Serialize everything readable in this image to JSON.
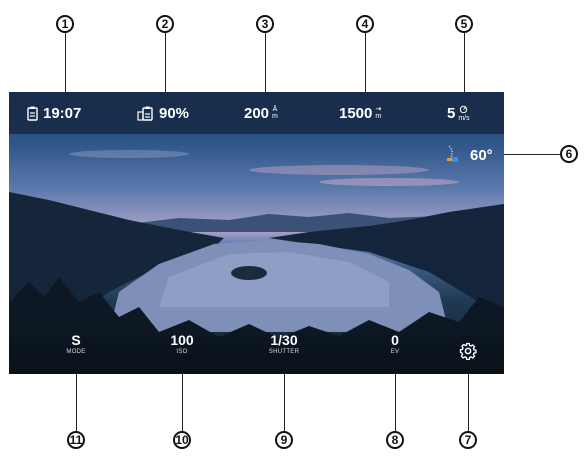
{
  "callouts": [
    "1",
    "2",
    "3",
    "4",
    "5",
    "6",
    "7",
    "8",
    "9",
    "10",
    "11"
  ],
  "status_bar": {
    "time": "19:07",
    "battery": "90%",
    "height": "200",
    "height_unit_top": "Ā",
    "height_unit_bottom": "m",
    "distance": "1500",
    "distance_unit_top": "⇥",
    "distance_unit_bottom": "m",
    "speed": "5",
    "speed_unit": "m/s"
  },
  "camera_tilt": "60°",
  "controls": {
    "mode": {
      "value": "S",
      "label": "MODE"
    },
    "iso": {
      "value": "100",
      "label": "ISO"
    },
    "shutter": {
      "value": "1/30",
      "label": "SHUTTER"
    },
    "ev": {
      "value": "0",
      "label": "EV"
    }
  },
  "icons": [
    "clipboard-battery-icon",
    "drone-battery-icon",
    "height-icon",
    "distance-icon",
    "speed-icon",
    "gimbal-tilt-icon",
    "settings-gear-icon"
  ],
  "colors": {
    "status_bar_bg": "#182a48",
    "text": "#ffffff",
    "callout": "#111111"
  }
}
